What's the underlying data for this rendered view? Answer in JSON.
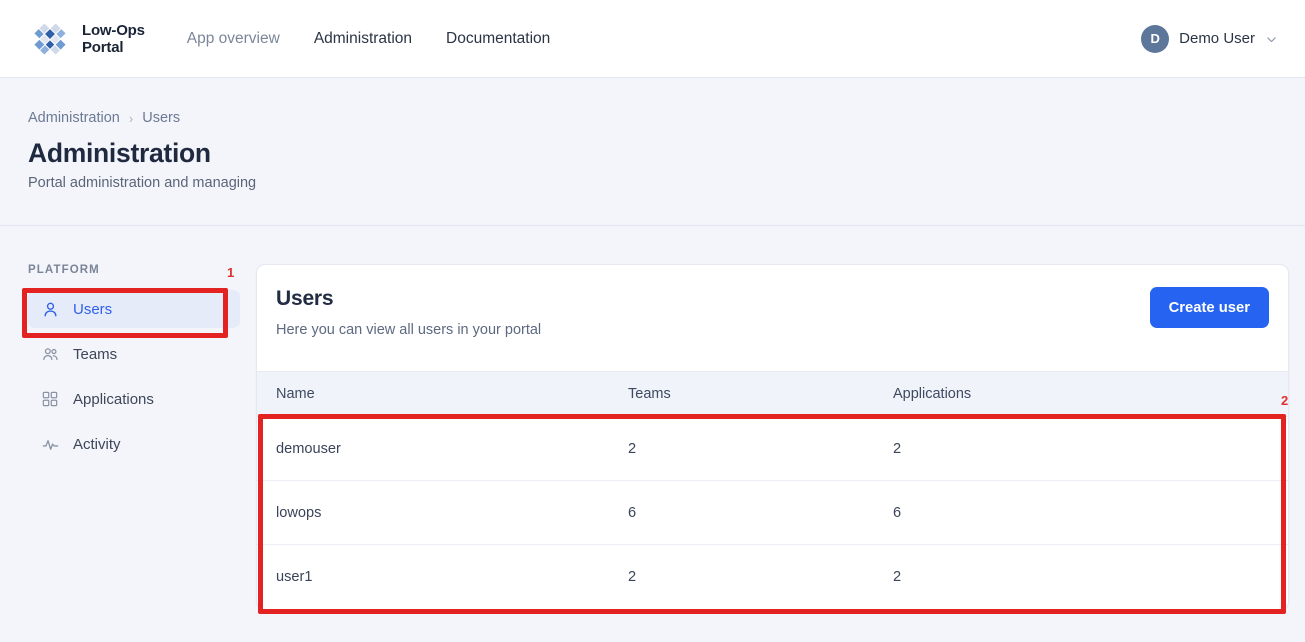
{
  "header": {
    "brand": {
      "line1": "Low-Ops",
      "line2": "Portal",
      "logo_icon": "diamond-grid-logo"
    },
    "nav": [
      {
        "label": "App overview",
        "state": "muted"
      },
      {
        "label": "Administration",
        "state": "normal"
      },
      {
        "label": "Documentation",
        "state": "normal"
      }
    ],
    "user": {
      "initial": "D",
      "name": "Demo User",
      "caret_icon": "chevron-down-icon"
    }
  },
  "breadcrumb": {
    "items": [
      "Administration",
      "Users"
    ],
    "separator": "›"
  },
  "page": {
    "title": "Administration",
    "subtitle": "Portal administration and managing"
  },
  "sidebar": {
    "section_label": "PLATFORM",
    "items": [
      {
        "label": "Users",
        "icon": "user-icon",
        "active": true
      },
      {
        "label": "Teams",
        "icon": "users-group-icon",
        "active": false
      },
      {
        "label": "Applications",
        "icon": "grid-squares-icon",
        "active": false
      },
      {
        "label": "Activity",
        "icon": "activity-pulse-icon",
        "active": false
      }
    ]
  },
  "card": {
    "title": "Users",
    "subtitle": "Here you can view all users in your portal",
    "create_button": "Create user"
  },
  "table": {
    "columns": [
      "Name",
      "Teams",
      "Applications"
    ],
    "rows": [
      {
        "name": "demouser",
        "teams": "2",
        "applications": "2"
      },
      {
        "name": "lowops",
        "teams": "6",
        "applications": "6"
      },
      {
        "name": "user1",
        "teams": "2",
        "applications": "2"
      }
    ]
  },
  "annotations": [
    {
      "number": "1",
      "target": "sidebar-item-users"
    },
    {
      "number": "2",
      "target": "users-table-body"
    }
  ],
  "colors": {
    "accent": "#2563f0",
    "active_nav": "#3060e8",
    "annotation": "#e32222",
    "page_bg": "#f4f5fa"
  }
}
